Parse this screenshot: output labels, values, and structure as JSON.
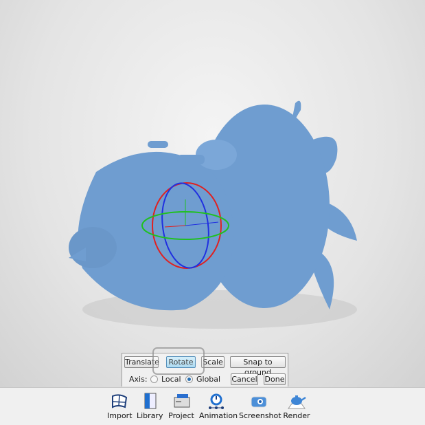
{
  "transform_panel": {
    "translate_label": "Translate",
    "rotate_label": "Rotate",
    "scale_label": "Scale",
    "snap_label": "Snap to ground",
    "active_mode": "Rotate",
    "axis_label": "Axis:",
    "local_label": "Local",
    "global_label": "Global",
    "selected_axis": "Global",
    "cancel_label": "Cancel",
    "done_label": "Done"
  },
  "toolbar": [
    {
      "label": "Import",
      "icon": "import-icon"
    },
    {
      "label": "Library",
      "icon": "library-icon"
    },
    {
      "label": "Project",
      "icon": "project-icon"
    },
    {
      "label": "Animation",
      "icon": "animation-icon"
    },
    {
      "label": "Screenshot",
      "icon": "screenshot-icon"
    },
    {
      "label": "Render",
      "icon": "render-icon"
    }
  ],
  "colors": {
    "model": "#6f9dd0",
    "gizmo_x": "#e02020",
    "gizmo_y": "#2030e0",
    "gizmo_z": "#20c020",
    "accent": "#2a6fb0"
  }
}
